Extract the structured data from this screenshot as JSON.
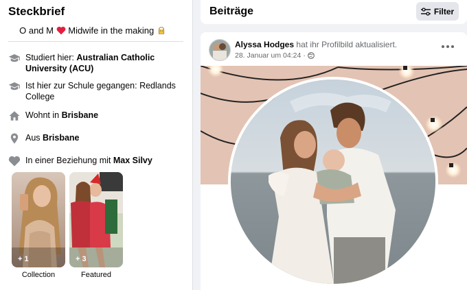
{
  "intro": {
    "title": "Steckbrief",
    "bio_before": "O and M",
    "bio_after": "Midwife in the making",
    "items": [
      {
        "icon": "graduation-cap-icon",
        "prefix": "Studiert hier: ",
        "bold": "Australian Catholic University (ACU)",
        "suffix": ""
      },
      {
        "icon": "graduation-cap-icon",
        "prefix": "Ist hier zur Schule gegangen: Redlands College",
        "bold": "",
        "suffix": ""
      },
      {
        "icon": "home-icon",
        "prefix": "Wohnt in ",
        "bold": "Brisbane",
        "suffix": ""
      },
      {
        "icon": "location-pin-icon",
        "prefix": "Aus ",
        "bold": "Brisbane",
        "suffix": ""
      },
      {
        "icon": "heart-icon",
        "prefix": "In einer Beziehung mit ",
        "bold": "Max Silvy",
        "suffix": ""
      }
    ],
    "featured": [
      {
        "count": "+ 1",
        "label": "Collection"
      },
      {
        "count": "+ 3",
        "label": "Featured"
      }
    ]
  },
  "posts": {
    "title": "Beiträge",
    "filter_label": "Filter"
  },
  "post": {
    "author": "Alyssa Hodges",
    "action": "hat ihr Profilbild aktualisiert.",
    "timestamp": "28. Januar um 04:24",
    "audience_icon": "globe-icon",
    "menu_icon": "more-horizontal-icon"
  },
  "colors": {
    "background": "#f0f2f5",
    "card": "#ffffff",
    "secondary_text": "#65676b",
    "icon_gray": "#65676b",
    "heart_red": "#e41e3f"
  }
}
